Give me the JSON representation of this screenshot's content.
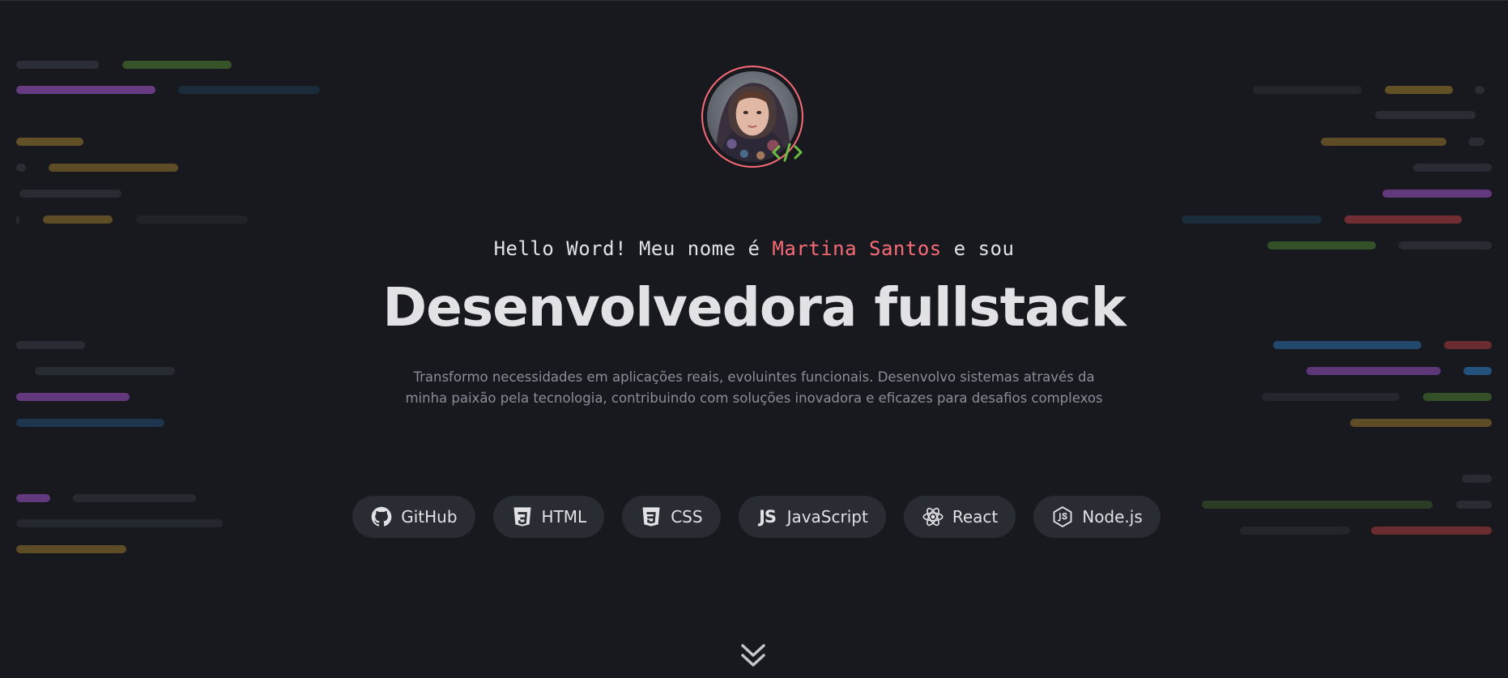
{
  "hero": {
    "intro_prefix": "Hello Word! Meu nome é ",
    "name": "Martina Santos",
    "intro_suffix": " e sou",
    "headline": "Desenvolvedora fullstack",
    "description_line1": "Transformo necessidades em aplicações reais, evoluintes funcionais. Desenvolvo sistemas através da",
    "description_line2": "minha paixão pela tecnologia, contribuindo com soluções inovadora e eficazes para desafios complexos"
  },
  "technologies": [
    {
      "label": "GitHub",
      "icon": "github-icon"
    },
    {
      "label": "HTML",
      "icon": "html5-icon"
    },
    {
      "label": "CSS",
      "icon": "css3-icon"
    },
    {
      "label": "JavaScript",
      "icon": "javascript-icon",
      "icon_text": "JS"
    },
    {
      "label": "React",
      "icon": "react-icon"
    },
    {
      "label": "Node.js",
      "icon": "nodejs-icon"
    }
  ],
  "icons": {
    "avatar": "profile-photo",
    "badge": "code-tag-icon",
    "scroll": "double-chevron-down-icon"
  },
  "colors": {
    "background": "#18191e",
    "accent": "#f76b77",
    "badge_green": "#6cbf43",
    "text_primary": "#e1e1e6",
    "text_muted": "#8d8d99",
    "chip_background": "#2a2c33"
  }
}
